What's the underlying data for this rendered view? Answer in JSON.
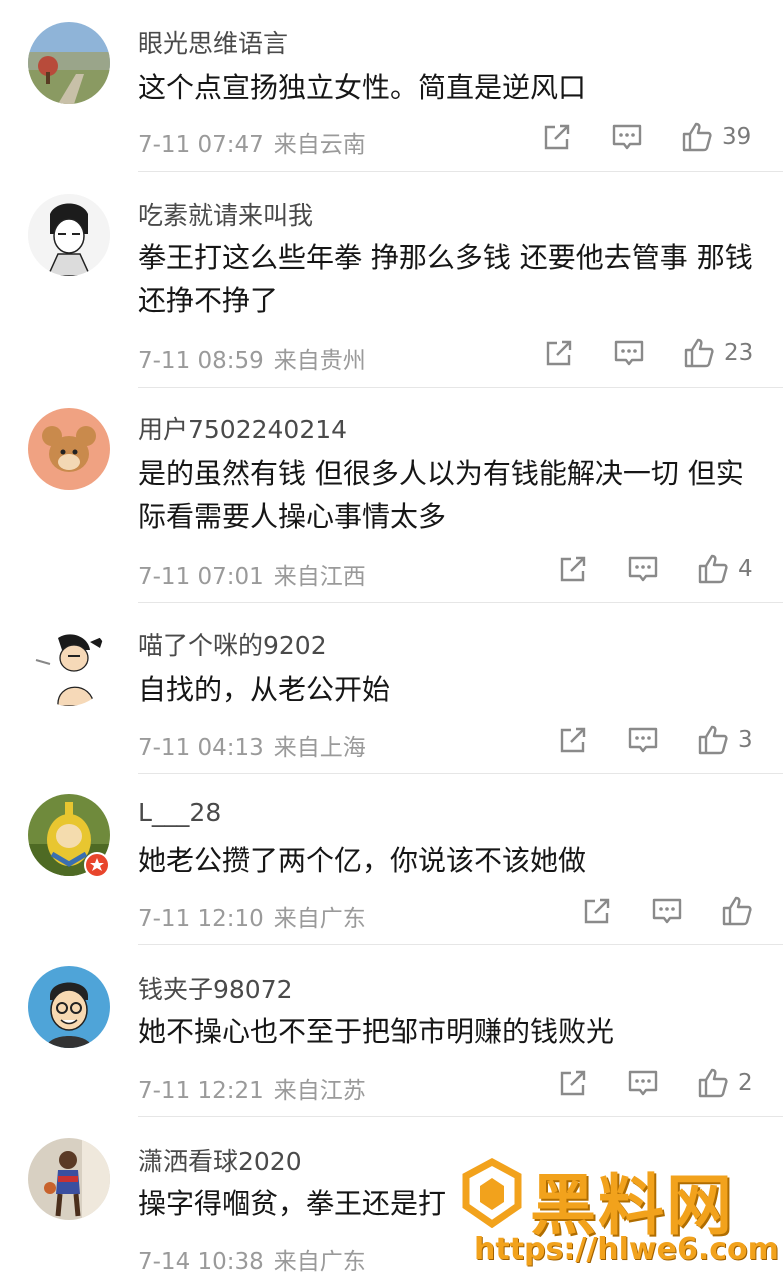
{
  "comments": [
    {
      "username": "眼光思维语言",
      "text": "这个点宣扬独立女性。简直是逆风口",
      "date": "7-11 07:47",
      "location": "来自云南",
      "likes": "39"
    },
    {
      "username": "吃素就请来叫我",
      "text": "拳王打这么些年拳 挣那么多钱 还要他去管事 那钱还挣不挣了",
      "date": "7-11 08:59",
      "location": "来自贵州",
      "likes": "23"
    },
    {
      "username": "用户7502240214",
      "text": "是的虽然有钱 但很多人以为有钱能解决一切 但实际看需要人操心事情太多",
      "date": "7-11 07:01",
      "location": "来自江西",
      "likes": "4"
    },
    {
      "username": "喵了个咪的9202",
      "text": "自找的，从老公开始",
      "date": "7-11 04:13",
      "location": "来自上海",
      "likes": "3"
    },
    {
      "username": "L___28",
      "text": "她老公攒了两个亿，你说该不该她做",
      "date": "7-11 12:10",
      "location": "来自广东",
      "likes": ""
    },
    {
      "username": "钱夹子98072",
      "text": "她不操心也不至于把邹市明赚的钱败光",
      "date": "7-11 12:21",
      "location": "来自江苏",
      "likes": "2"
    },
    {
      "username": "潇洒看球2020",
      "text": "操字得嗰贫，拳王还是打",
      "date": "7-14 10:38",
      "location": "来自广东",
      "likes": ""
    }
  ],
  "watermark": {
    "title": "黑料网",
    "url": "https://hlwe6.com"
  },
  "icons": {
    "share": "share-icon",
    "reply": "comment-icon",
    "like": "thumbs-up-icon"
  },
  "colors": {
    "meta": "#9a9a9a",
    "icon": "#8a8a8a",
    "watermark": "#f2a21c"
  }
}
